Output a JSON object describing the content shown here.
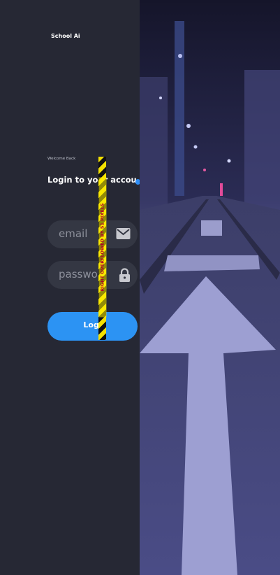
{
  "app": {
    "title": "School Ai"
  },
  "login": {
    "welcome": "Welcome Back",
    "heading": "Login to your account",
    "email_placeholder": "email",
    "password_placeholder": "passwo..",
    "button_label": "Logi"
  },
  "debug": {
    "overflow_message": "RIGHT OVERFLOWED BY 51 PIXELS"
  },
  "background": {
    "description_colors": {
      "sky": "#1a1a2e",
      "road": "#4b4d86",
      "arrow": "#a7a7d6"
    }
  },
  "colors": {
    "panel_bg": "#262834",
    "field_bg": "#343743",
    "accent": "#2c93f3"
  }
}
